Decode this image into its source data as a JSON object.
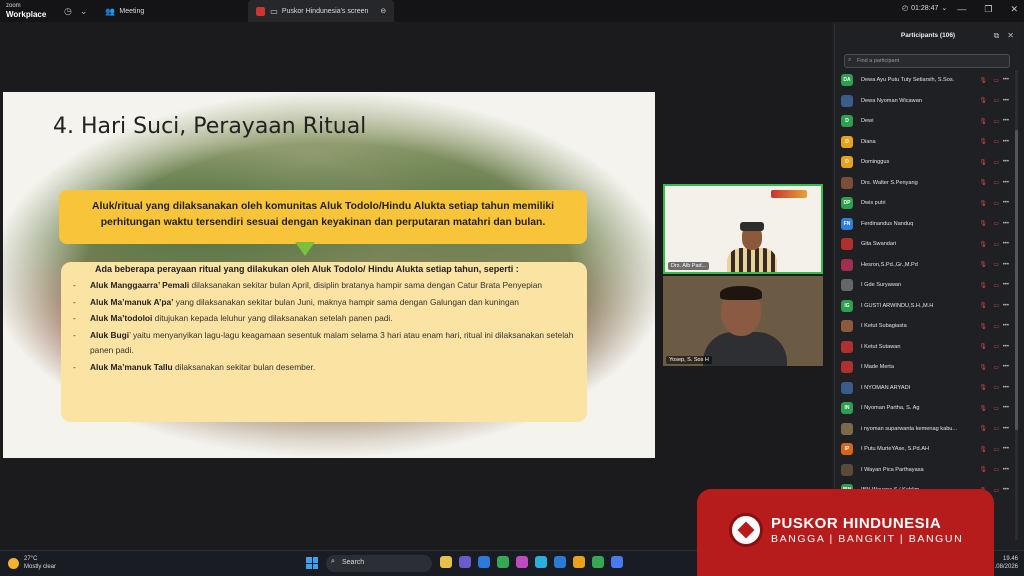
{
  "titlebar": {
    "brand_small": "zoom",
    "brand": "Workplace",
    "tab_meeting": "Meeting",
    "tab_share": "Puskor Hindunesia's screen",
    "timer": "01:28:47"
  },
  "slide": {
    "title": "4. Hari Suci, Perayaan Ritual",
    "box1": "Aluk/ritual yang dilaksanakan oleh komunitas Aluk Todolo/Hindu Alukta setiap tahun memiliki perhitungan waktu tersendiri sesuai dengan keyakinan dan perputaran matahri dan bulan.",
    "intro": "Ada beberapa perayaan ritual yang dilakukan oleh Aluk Todolo/ Hindu Alukta setiap tahun, seperti :",
    "items": [
      {
        "dash": "-",
        "bold": "Aluk Manggaarra’ Pemali",
        "text": " dilaksanakan sekitar bulan April, disiplin bratanya hampir sama dengan Catur Brata Penyepian"
      },
      {
        "dash": "-",
        "bold": "Aluk Ma’manuk A’pa’",
        "text": " yang dilaksanakan sekitar bulan Juni, maknya hampir sama dengan Galungan dan kuningan"
      },
      {
        "dash": "-",
        "bold": "Aluk Ma’todoloi",
        "text": " ditujukan kepada leluhur yang dilaksanakan setelah panen padi."
      },
      {
        "dash": "-",
        "bold": "Aluk Bugi",
        "text": "’ yaitu menyanyikan lagu-lagu keagamaan sesentuk malam selama 3 hari atau enam hari, ritual ini dilaksanakan setelah panen padi."
      },
      {
        "dash": "-",
        "bold": "Aluk Ma’manuk Tallu",
        "text": " dilaksanakan sekitar bulan desember."
      }
    ]
  },
  "videos": [
    {
      "label": "Drs. Alb Pad..."
    },
    {
      "label": "Yosep, S. Sos H"
    }
  ],
  "participants": {
    "title": "Participants (106)",
    "search_placeholder": "Find a participant",
    "list": [
      {
        "initials": "DA",
        "color": "#2e9e4f",
        "name": "Dewa Ayu Putu Tuty Setiarsih, S.Sos."
      },
      {
        "initials": "",
        "color": "#3b5c8a",
        "name": "Dewa Nyoman Wicawan"
      },
      {
        "initials": "D",
        "color": "#2e9e4f",
        "name": "Dewi"
      },
      {
        "initials": "D",
        "color": "#e8a21c",
        "name": "Diana"
      },
      {
        "initials": "D",
        "color": "#e8a21c",
        "name": "Dominggus"
      },
      {
        "initials": "",
        "color": "#7a4e3a",
        "name": "Drs. Walter S.Penyang"
      },
      {
        "initials": "DP",
        "color": "#2e9e4f",
        "name": "Dwis putri"
      },
      {
        "initials": "FN",
        "color": "#2f7fd8",
        "name": "Ferdinandus Nanduq"
      },
      {
        "initials": "",
        "color": "#b03030",
        "name": "Gita Swandari"
      },
      {
        "initials": "",
        "color": "#a03050",
        "name": "Hesron,S.Pd.,Gr.,M.Pd"
      },
      {
        "initials": "",
        "color": "#666666",
        "name": "I Gde Suryawan"
      },
      {
        "initials": "IG",
        "color": "#2e9e4f",
        "name": "I GUSTI ARWINDU,S.H.,M.H"
      },
      {
        "initials": "",
        "color": "#8a5a3a",
        "name": "I Ketut Subagiasta"
      },
      {
        "initials": "",
        "color": "#b03030",
        "name": "I Ketut Sutawan"
      },
      {
        "initials": "",
        "color": "#b03030",
        "name": "I Made Merta"
      },
      {
        "initials": "",
        "color": "#3b5c8a",
        "name": "I NYOMAN ARYADI"
      },
      {
        "initials": "IN",
        "color": "#2e9e4f",
        "name": "I Nyoman Partha, S. Ag"
      },
      {
        "initials": "",
        "color": "#7a6a4a",
        "name": "i nyoman suparwanta kemenag kabu..."
      },
      {
        "initials": "IP",
        "color": "#d8641c",
        "name": "I Putu MurteYAse, S.Pd.AH"
      },
      {
        "initials": "",
        "color": "#5a4a3a",
        "name": "I Wayan Pica Parthayasa"
      },
      {
        "initials": "IBN",
        "color": "#2e9e4f",
        "name": "IBN Wayana S / Kahlim"
      }
    ]
  },
  "taskbar": {
    "temp": "27°C",
    "weather": "Mostly clear",
    "search": "Search",
    "time": "19.46",
    "date": "...08/2026"
  },
  "banner": {
    "name": "PUSKOR HINDUNESIA",
    "tagline": "BANGGA | BANGKIT | BANGUN"
  }
}
